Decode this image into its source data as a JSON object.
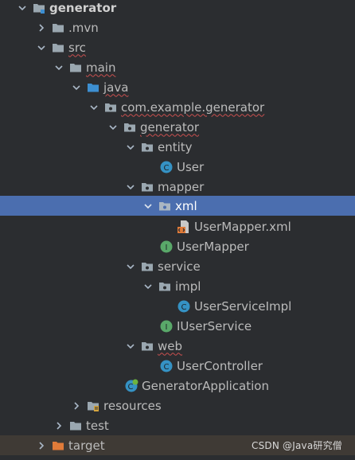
{
  "tree": {
    "project": "generator",
    "mvn": ".mvn",
    "src": "src",
    "main": "main",
    "java": "java",
    "package": "com.example.generator",
    "generator": "generator",
    "entity": "entity",
    "user": "User",
    "mapper": "mapper",
    "xml": "xml",
    "user_mapper_xml": "UserMapper.xml",
    "user_mapper": "UserMapper",
    "service": "service",
    "impl": "impl",
    "user_service_impl": "UserServiceImpl",
    "iuser_service": "IUserService",
    "web": "web",
    "user_controller": "UserController",
    "generator_application": "GeneratorApplication",
    "resources": "resources",
    "test": "test",
    "target": "target"
  },
  "watermark": "CSDN @Java研究僧",
  "colors": {
    "background": "#2b2d30",
    "selected_row": "#4b6eaf",
    "folder": "#9aa7b0",
    "source_folder": "#3d8fd1",
    "target_folder": "#e07b39",
    "class_icon": "#3592c4",
    "interface_icon": "#59a869"
  }
}
